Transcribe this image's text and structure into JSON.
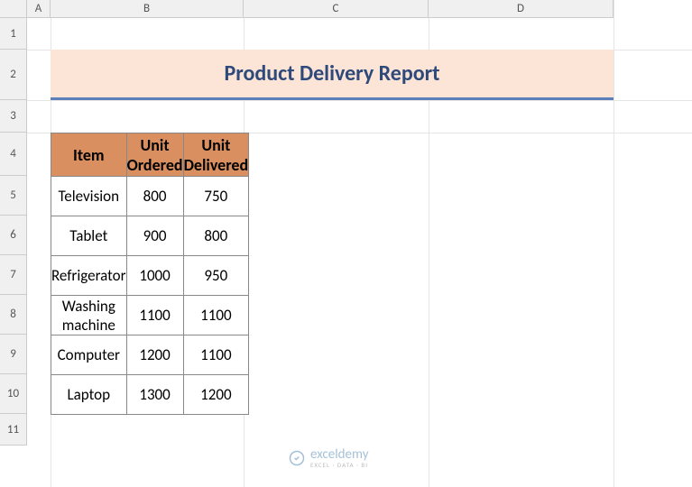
{
  "columns": [
    "A",
    "B",
    "C",
    "D"
  ],
  "rows": [
    "1",
    "2",
    "3",
    "4",
    "5",
    "6",
    "7",
    "8",
    "9",
    "10",
    "11"
  ],
  "title": "Product Delivery Report",
  "headers": {
    "item": "Item",
    "ordered": "Unit Ordered",
    "delivered": "Unit Delivered"
  },
  "data": [
    {
      "item": "Television",
      "ordered": "800",
      "delivered": "750"
    },
    {
      "item": "Tablet",
      "ordered": "900",
      "delivered": "800"
    },
    {
      "item": "Refrigerator",
      "ordered": "1000",
      "delivered": "950"
    },
    {
      "item": "Washing machine",
      "ordered": "1100",
      "delivered": "1100"
    },
    {
      "item": "Computer",
      "ordered": "1200",
      "delivered": "1100"
    },
    {
      "item": "Laptop",
      "ordered": "1300",
      "delivered": "1200"
    }
  ],
  "watermark": {
    "brand": "exceldemy",
    "tagline": "EXCEL · DATA · BI"
  },
  "chart_data": {
    "type": "table",
    "title": "Product Delivery Report",
    "columns": [
      "Item",
      "Unit Ordered",
      "Unit Delivered"
    ],
    "rows": [
      [
        "Television",
        800,
        750
      ],
      [
        "Tablet",
        900,
        800
      ],
      [
        "Refrigerator",
        1000,
        950
      ],
      [
        "Washing machine",
        1100,
        1100
      ],
      [
        "Computer",
        1200,
        1100
      ],
      [
        "Laptop",
        1300,
        1200
      ]
    ]
  }
}
